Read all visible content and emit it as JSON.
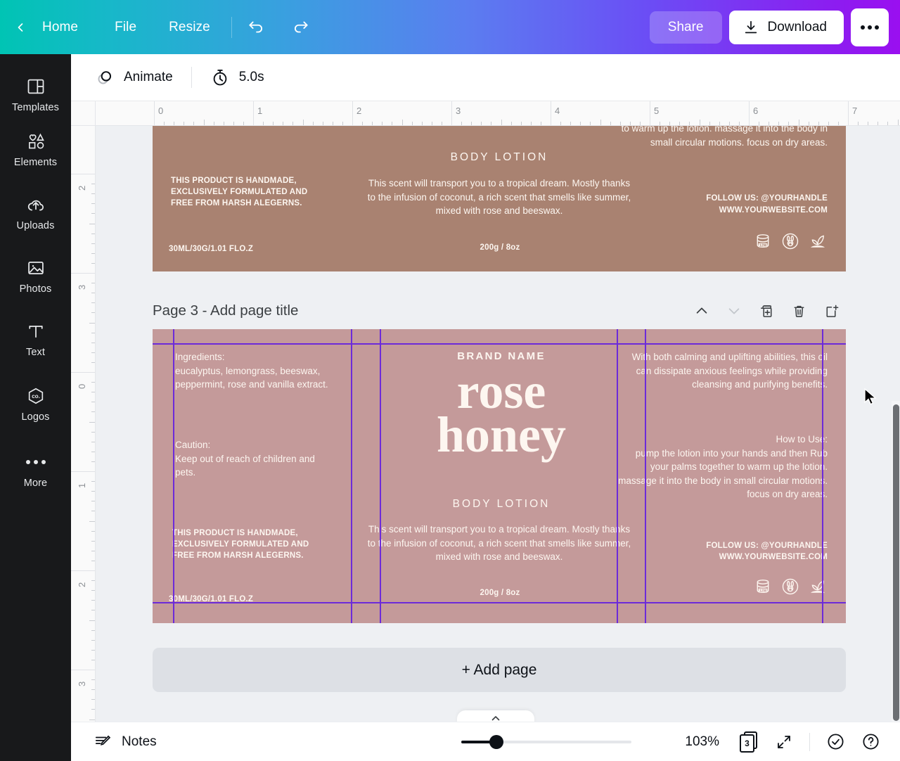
{
  "topbar": {
    "back_icon": "chevron-left-icon",
    "home_label": "Home",
    "file_label": "File",
    "resize_label": "Resize",
    "undo_icon": "undo-icon",
    "redo_icon": "redo-icon",
    "share_label": "Share",
    "download_label": "Download",
    "download_icon": "download-icon",
    "more_icon": "more-horizontal-icon",
    "gradient_start": "#00c4b4",
    "gradient_end": "#9a0ff0"
  },
  "sidebar": {
    "items": [
      {
        "label": "Templates",
        "icon": "templates-icon"
      },
      {
        "label": "Elements",
        "icon": "elements-icon"
      },
      {
        "label": "Uploads",
        "icon": "cloud-upload-icon"
      },
      {
        "label": "Photos",
        "icon": "photo-icon"
      },
      {
        "label": "Text",
        "icon": "text-icon"
      },
      {
        "label": "Logos",
        "icon": "logos-icon"
      },
      {
        "label": "More",
        "icon": "more-dots-icon"
      }
    ]
  },
  "toolbar": {
    "animate_label": "Animate",
    "animate_icon": "animate-circles-icon",
    "duration_label": "5.0s",
    "duration_icon": "stopwatch-icon"
  },
  "rulers": {
    "horizontal_ticks": [
      "0",
      "1",
      "2",
      "3",
      "4",
      "5",
      "6",
      "7"
    ],
    "vertical_ticks": [
      "2",
      "3",
      "0",
      "1",
      "2",
      "3"
    ]
  },
  "page_header": {
    "title": "Page 3 - Add page title",
    "actions": [
      {
        "name": "move-page-up",
        "icon": "chevron-up-icon",
        "enabled": true
      },
      {
        "name": "move-page-down",
        "icon": "chevron-down-icon",
        "enabled": false
      },
      {
        "name": "duplicate-page",
        "icon": "duplicate-icon",
        "enabled": true
      },
      {
        "name": "delete-page",
        "icon": "trash-icon",
        "enabled": true
      },
      {
        "name": "add-page-after",
        "icon": "add-page-icon",
        "enabled": true
      }
    ]
  },
  "add_page_button": {
    "label": "+ Add page"
  },
  "design": {
    "page_top": {
      "background_color": "#a98271",
      "body_lotion": "BODY LOTION",
      "scent_text": "This scent will transport you to a tropical dream. Mostly thanks to the infusion of coconut, a rich scent that smells like summer, mixed with rose and beeswax.",
      "handmade_text": "THIS PRODUCT IS HANDMADE, EXCLUSIVELY FORMULATED AND FREE FROM HARSH ALEGERNS.",
      "volume_left": "30ML/30G/1.01 FLO.Z",
      "weight_center": "200g / 8oz",
      "how_to_use_tail": "to warm up the lotion. massage it into the body in small circular motions. focus on dry areas.",
      "follow_us": "FOLLOW US: @YOURHANDLE",
      "website": "WWW.YOURWEBSITE.COM",
      "badges": [
        "jar-12m-icon",
        "cruelty-free-bunny-icon",
        "plant-based-icon"
      ]
    },
    "page_3": {
      "background_color": "#c49a9a",
      "guide_color": "#6c2bd9",
      "brand_name": "BRAND NAME",
      "hero_line1": "rose",
      "hero_line2": "honey",
      "body_lotion": "BODY LOTION",
      "scent_text": "This scent will transport you to a tropical dream. Mostly thanks to the infusion of coconut, a rich scent that smells like summer, mixed with rose and beeswax.",
      "weight_center": "200g / 8oz",
      "ingredients_heading": "Ingredients:",
      "ingredients_text": "eucalyptus, lemongrass, beeswax, peppermint, rose and vanilla extract.",
      "caution_heading": "Caution:",
      "caution_text": "Keep out of reach of children and pets.",
      "handmade_text": "THIS PRODUCT IS HANDMADE, EXCLUSIVELY FORMULATED AND FREE FROM HARSH ALEGERNS.",
      "volume_left": "30ML/30G/1.01 FLO.Z",
      "benefits_text": "With both calming and uplifting abilities, this oil can dissipate anxious feelings while providing cleansing and purifying benefits.",
      "how_to_use_heading": "How to Use:",
      "how_to_use_text": "pump the lotion into your hands and then Rub your palms together to warm up the lotion. massage it into the body in small circular motions. focus on dry areas.",
      "follow_us": "FOLLOW US: @YOURHANDLE",
      "website": "WWW.YOURWEBSITE.COM",
      "badges": [
        "jar-12m-icon",
        "cruelty-free-bunny-icon",
        "plant-based-icon"
      ]
    }
  },
  "bottombar": {
    "notes_label": "Notes",
    "notes_icon": "notes-pencil-icon",
    "zoom_percent": "103%",
    "page_count": "3",
    "expand_icon": "fullscreen-icon",
    "check_icon": "check-circle-icon",
    "help_icon": "help-circle-icon",
    "collapse_icon": "chevron-up-icon"
  }
}
